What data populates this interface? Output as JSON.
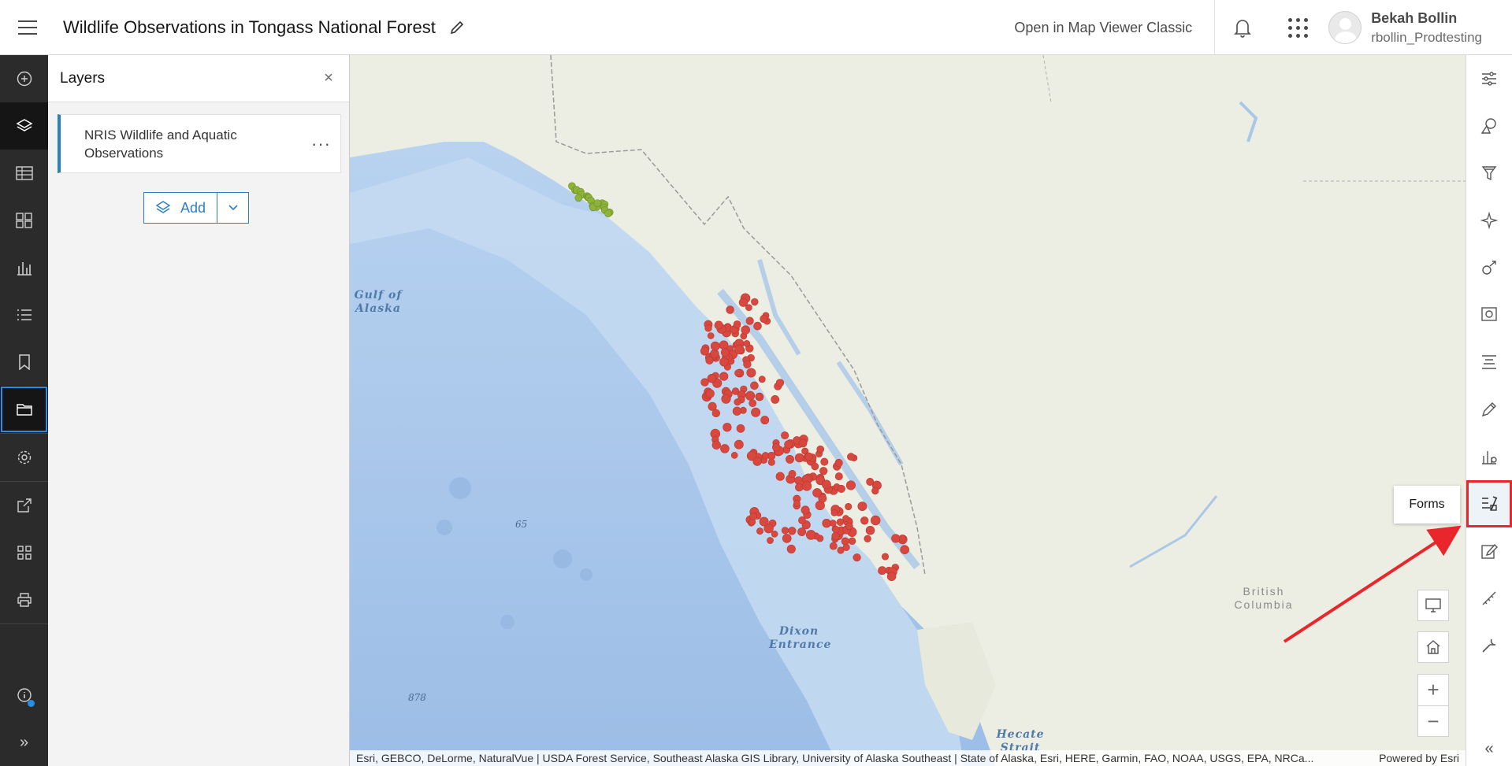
{
  "header": {
    "title": "Wildlife Observations in Tongass National Forest",
    "classic_link": "Open in Map Viewer Classic",
    "user_name": "Bekah Bollin",
    "user_id": "rbollin_Prodtesting"
  },
  "leftnav": {
    "items": [
      "add-icon",
      "layers-icon",
      "table-icon",
      "basemap-icon",
      "charts-icon",
      "legend-icon",
      "bookmarks-icon",
      "folder-icon",
      "settings-icon",
      "share-icon",
      "apps-icon",
      "print-icon"
    ],
    "bottom": [
      "info-icon",
      "expand-icon"
    ]
  },
  "layers_panel": {
    "title": "Layers",
    "close": "×",
    "layer_name": "NRIS Wildlife and Aquatic Observations",
    "more": "···",
    "add_label": "Add"
  },
  "map": {
    "labels": {
      "gulf": "Gulf of Alaska",
      "dixon": "Dixon Entrance",
      "hecate": "Hecate Strait",
      "bc": "British Columbia",
      "depth1": "65",
      "depth2": "878"
    },
    "attribution": "Esri, GEBCO, DeLorme, NaturalVue | USDA Forest Service, Southeast Alaska GIS Library, University of Alaska Southeast | State of Alaska, Esri, HERE, Garmin, FAO, NOAA, USGS, EPA, NRCa...",
    "powered_by": "Powered by Esri",
    "colors": {
      "observation": "#d9483f",
      "observation_alt": "#8db33a",
      "ocean": "#a9c8ec",
      "land": "#eef0e6"
    }
  },
  "rightbar": {
    "items": [
      "properties-icon",
      "styles-icon",
      "filter-icon",
      "effects-icon",
      "pop-ups-icon",
      "configure-icon",
      "labels-icon",
      "sketch-icon",
      "analysis-icon",
      "forms-icon",
      "edit-icon",
      "measure-icon",
      "tools-icon"
    ],
    "highlighted": "forms-icon",
    "tooltip": "Forms"
  }
}
